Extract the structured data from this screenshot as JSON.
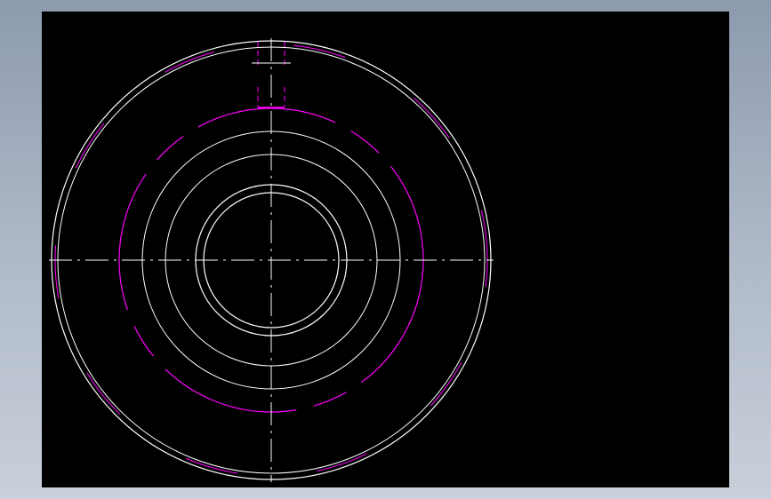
{
  "viewer": {
    "background": "#000000",
    "frame_gradient": [
      "#8d9aae",
      "#c9d0da"
    ]
  },
  "drawing": {
    "colors": {
      "outline": "#ffffff",
      "hidden": "#ff00ff",
      "centerline": "#ffffff"
    },
    "views": [
      "front-view-circular"
    ],
    "features": [
      "outer-rim-circle",
      "inner-rim-circle",
      "pitch-circle-dashed",
      "hub-circle-1",
      "hub-circle-2",
      "bore-circle-outer",
      "bore-circle-inner",
      "keyway-slot",
      "horizontal-centerline",
      "vertical-centerline"
    ]
  }
}
